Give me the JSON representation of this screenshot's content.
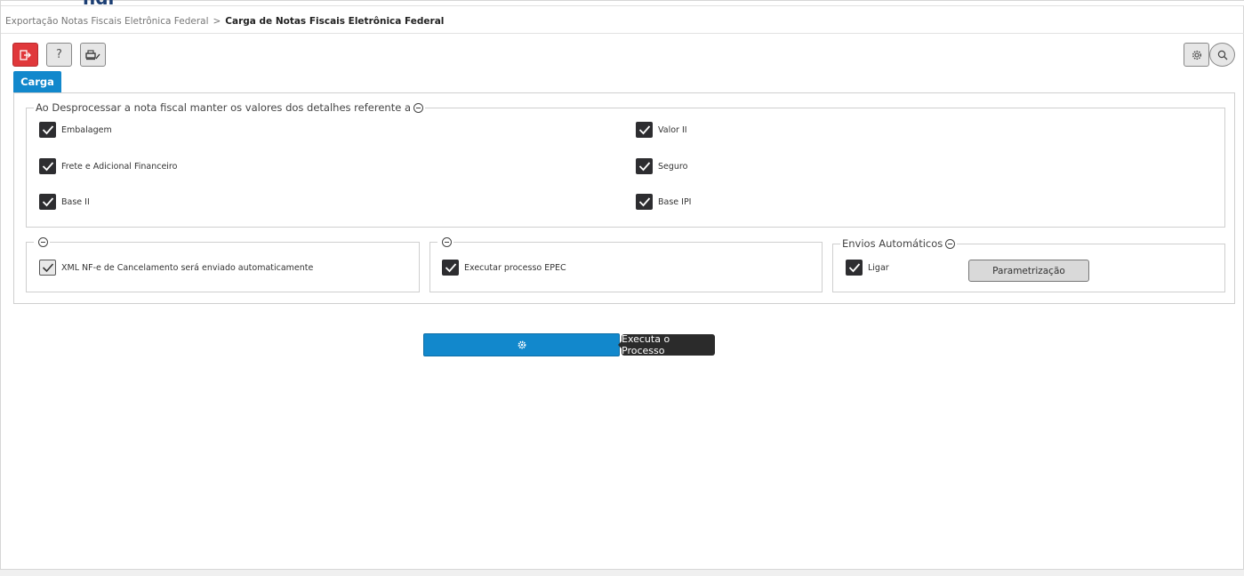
{
  "breadcrumb": {
    "previous": "Exportação Notas Fiscais Eletrônica Federal",
    "separator": ">",
    "current": "Carga de Notas Fiscais Eletrônica Federal"
  },
  "toolbar": {
    "exit_icon": "exit-icon",
    "help_label": "?",
    "print_icon": "print-settings-icon",
    "settings_icon": "gear-icon",
    "search_icon": "search-icon"
  },
  "tabs": [
    {
      "label": "Carga",
      "active": true
    }
  ],
  "reprocess_group": {
    "legend": "Ao Desprocessar a nota fiscal manter os valores dos detalhes referente a",
    "items": [
      {
        "label": "Embalagem",
        "checked": true
      },
      {
        "label": "Valor II",
        "checked": true
      },
      {
        "label": "Frete e Adicional Financeiro",
        "checked": true
      },
      {
        "label": "Seguro",
        "checked": true
      },
      {
        "label": "Base II",
        "checked": true
      },
      {
        "label": "Base IPI",
        "checked": true
      }
    ]
  },
  "xml_group": {
    "legend": "",
    "item": {
      "label": "XML NF-e de Cancelamento será enviado automaticamente",
      "checked": true
    }
  },
  "epec_group": {
    "legend": "",
    "item": {
      "label": "Executar processo EPEC",
      "checked": true
    }
  },
  "auto_group": {
    "legend": "Envios Automáticos",
    "item": {
      "label": "Ligar",
      "checked": true
    },
    "button_label": "Parametrização"
  },
  "execute": {
    "icon": "gear-icon",
    "tooltip": "Executa o Processo"
  },
  "colors": {
    "primary": "#1288cc",
    "exit_red": "#e0383b",
    "checkbox_dark": "#2d2d30",
    "tooltip_bg": "#2b2b2b"
  }
}
